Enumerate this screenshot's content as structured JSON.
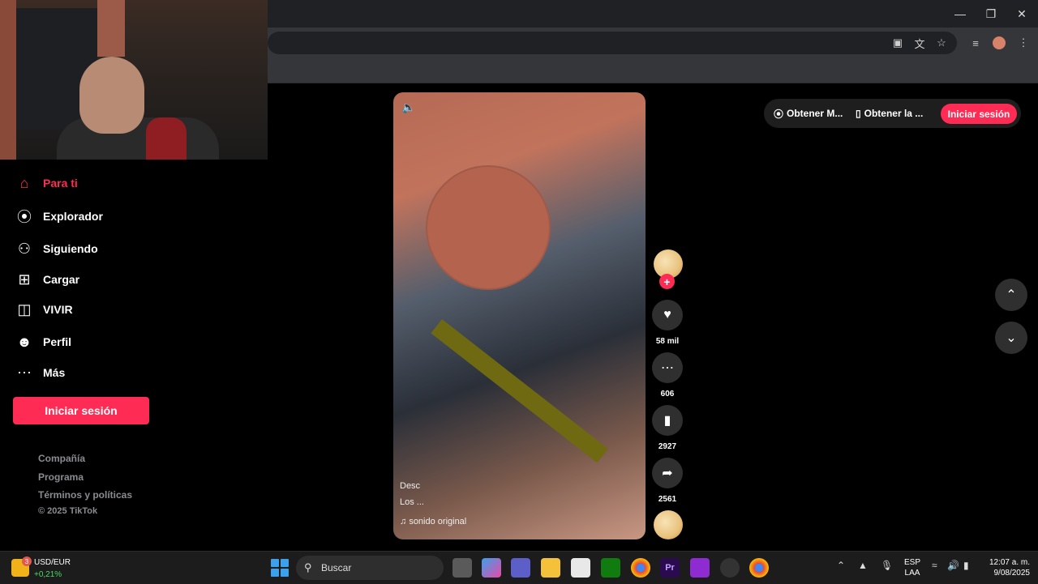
{
  "sidebar": {
    "items": [
      {
        "label": "Para ti",
        "icon": "home-icon"
      },
      {
        "label": "Explorador",
        "icon": "compass-icon"
      },
      {
        "label": "Siguiendo",
        "icon": "user-follow-icon"
      },
      {
        "label": "Cargar",
        "icon": "upload-icon"
      },
      {
        "label": "VIVIR",
        "icon": "live-tv-icon"
      },
      {
        "label": "Perfil",
        "icon": "profile-icon"
      },
      {
        "label": "Más",
        "icon": "more-icon"
      }
    ],
    "login_label": "Iniciar sesión",
    "footer": [
      "Compañía",
      "Programa",
      "Términos y políticas",
      "© 2025 TikTok"
    ]
  },
  "top_pill": {
    "get_app_1": "Obtener M...",
    "get_app_2": "Obtener la ...",
    "login_label": "Iniciar sesión"
  },
  "video": {
    "caption_line1": "Desc",
    "caption_line2": "Los ...",
    "sound": "sonido original"
  },
  "actions": {
    "likes": "58 mil",
    "comments": "606",
    "saves": "2927",
    "shares": "2561"
  },
  "taskbar": {
    "widget_title": "USD/EUR",
    "widget_value": "+0,21%",
    "widget_badge": "3",
    "search_label": "Buscar",
    "lang_line1": "ESP",
    "lang_line2": "LAA",
    "time": "12:07 a. m.",
    "date": "9/08/2025"
  },
  "colors": {
    "accent": "#fe2c55",
    "background": "#000000",
    "button_bg": "#2f2f2f"
  }
}
